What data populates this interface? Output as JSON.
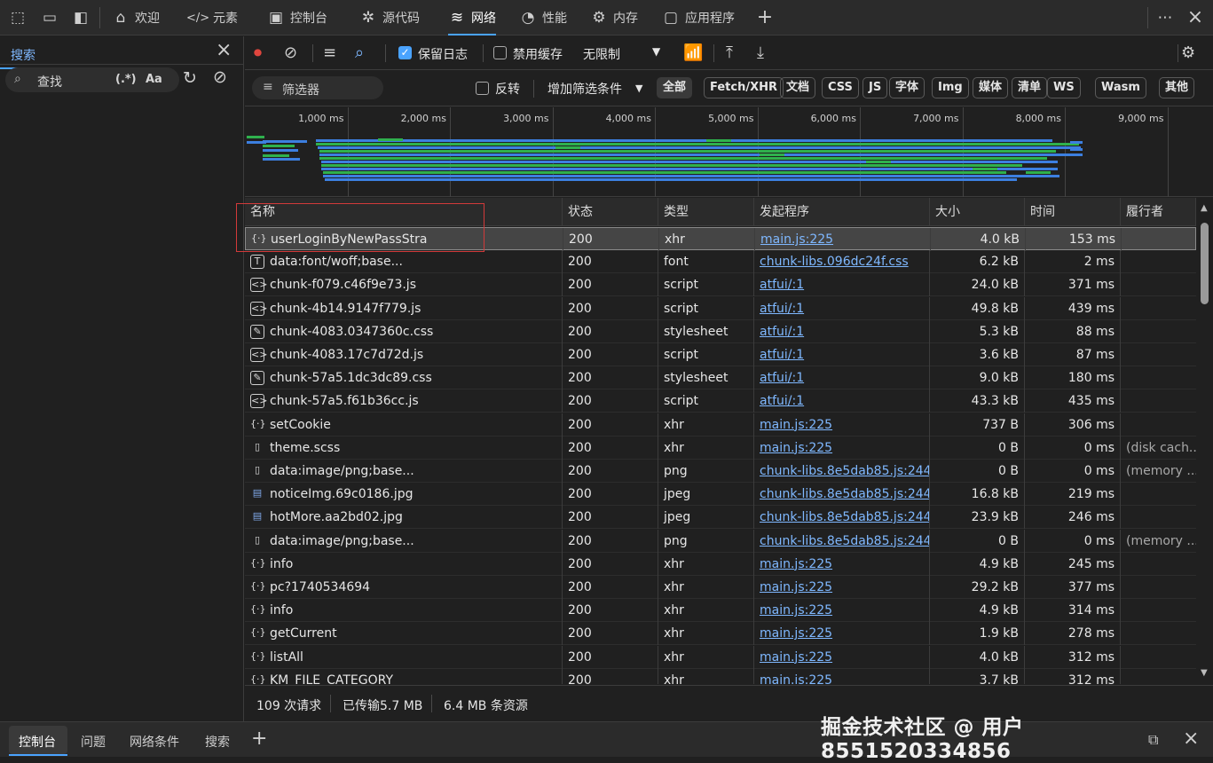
{
  "tabs": [
    {
      "label": "欢迎",
      "icon": "home-icon"
    },
    {
      "label": "元素",
      "icon": "code-icon"
    },
    {
      "label": "控制台",
      "icon": "console-icon"
    },
    {
      "label": "源代码",
      "icon": "bug-icon"
    },
    {
      "label": "网络",
      "icon": "wifi-icon",
      "active": true
    },
    {
      "label": "性能",
      "icon": "gauge-icon"
    },
    {
      "label": "内存",
      "icon": "chip-icon"
    },
    {
      "label": "应用程序",
      "icon": "window-icon"
    }
  ],
  "search_panel": {
    "title": "搜索",
    "placeholder": "查找",
    "regex_label": "(.*)",
    "case_label": "Aa"
  },
  "toolbar": {
    "preserve_log": "保留日志",
    "preserve_log_checked": true,
    "disable_cache": "禁用缓存",
    "disable_cache_checked": false,
    "throttling": "无限制"
  },
  "filter": {
    "placeholder": "筛选器",
    "invert": "反转",
    "more_filters": "增加筛选条件",
    "types": [
      "全部",
      "Fetch/XHR",
      "文档",
      "CSS",
      "JS",
      "字体",
      "Img",
      "媒体",
      "清单",
      "WS",
      "Wasm",
      "其他"
    ]
  },
  "timeline": {
    "ticks": [
      "1,000 ms",
      "2,000 ms",
      "3,000 ms",
      "4,000 ms",
      "5,000 ms",
      "6,000 ms",
      "7,000 ms",
      "8,000 ms",
      "9,000 ms"
    ]
  },
  "columns": [
    "名称",
    "状态",
    "类型",
    "发起程序",
    "大小",
    "时间",
    "履行者"
  ],
  "rows": [
    {
      "name": "userLoginByNewPassStra",
      "icon": "xhr-icon",
      "status": "200",
      "type": "xhr",
      "initiator": "main.js:225",
      "size": "4.0 kB",
      "time": "153 ms",
      "fulfilled": "",
      "selected": true
    },
    {
      "name": "data:font/woff;base...",
      "icon": "font-icon",
      "status": "200",
      "type": "font",
      "initiator": "chunk-libs.096dc24f.css",
      "size": "6.2 kB",
      "time": "2 ms",
      "fulfilled": ""
    },
    {
      "name": "chunk-f079.c46f9e73.js",
      "icon": "script-icon",
      "status": "200",
      "type": "script",
      "initiator": "atfui/:1",
      "size": "24.0 kB",
      "time": "371 ms",
      "fulfilled": ""
    },
    {
      "name": "chunk-4b14.9147f779.js",
      "icon": "script-icon",
      "status": "200",
      "type": "script",
      "initiator": "atfui/:1",
      "size": "49.8 kB",
      "time": "439 ms",
      "fulfilled": ""
    },
    {
      "name": "chunk-4083.0347360c.css",
      "icon": "stylesheet-icon",
      "status": "200",
      "type": "stylesheet",
      "initiator": "atfui/:1",
      "size": "5.3 kB",
      "time": "88 ms",
      "fulfilled": ""
    },
    {
      "name": "chunk-4083.17c7d72d.js",
      "icon": "script-icon",
      "status": "200",
      "type": "script",
      "initiator": "atfui/:1",
      "size": "3.6 kB",
      "time": "87 ms",
      "fulfilled": ""
    },
    {
      "name": "chunk-57a5.1dc3dc89.css",
      "icon": "stylesheet-icon",
      "status": "200",
      "type": "stylesheet",
      "initiator": "atfui/:1",
      "size": "9.0 kB",
      "time": "180 ms",
      "fulfilled": ""
    },
    {
      "name": "chunk-57a5.f61b36cc.js",
      "icon": "script-icon",
      "status": "200",
      "type": "script",
      "initiator": "atfui/:1",
      "size": "43.3 kB",
      "time": "435 ms",
      "fulfilled": ""
    },
    {
      "name": "setCookie",
      "icon": "xhr-icon",
      "status": "200",
      "type": "xhr",
      "initiator": "main.js:225",
      "size": "737 B",
      "time": "306 ms",
      "fulfilled": ""
    },
    {
      "name": "theme.scss",
      "icon": "document-icon",
      "status": "200",
      "type": "xhr",
      "initiator": "main.js:225",
      "size": "0 B",
      "time": "0 ms",
      "fulfilled": "(disk cach..."
    },
    {
      "name": "data:image/png;base...",
      "icon": "document-icon",
      "status": "200",
      "type": "png",
      "initiator": "chunk-libs.8e5dab85.js:244",
      "size": "0 B",
      "time": "0 ms",
      "fulfilled": "(memory ..."
    },
    {
      "name": "noticeImg.69c0186.jpg",
      "icon": "image-icon",
      "status": "200",
      "type": "jpeg",
      "initiator": "chunk-libs.8e5dab85.js:244",
      "size": "16.8 kB",
      "time": "219 ms",
      "fulfilled": ""
    },
    {
      "name": "hotMore.aa2bd02.jpg",
      "icon": "image-icon",
      "status": "200",
      "type": "jpeg",
      "initiator": "chunk-libs.8e5dab85.js:244",
      "size": "23.9 kB",
      "time": "246 ms",
      "fulfilled": ""
    },
    {
      "name": "data:image/png;base...",
      "icon": "document-icon",
      "status": "200",
      "type": "png",
      "initiator": "chunk-libs.8e5dab85.js:244",
      "size": "0 B",
      "time": "0 ms",
      "fulfilled": "(memory ..."
    },
    {
      "name": "info",
      "icon": "xhr-icon",
      "status": "200",
      "type": "xhr",
      "initiator": "main.js:225",
      "size": "4.9 kB",
      "time": "245 ms",
      "fulfilled": ""
    },
    {
      "name": "pc?1740534694",
      "icon": "xhr-icon",
      "status": "200",
      "type": "xhr",
      "initiator": "main.js:225",
      "size": "29.2 kB",
      "time": "377 ms",
      "fulfilled": ""
    },
    {
      "name": "info",
      "icon": "xhr-icon",
      "status": "200",
      "type": "xhr",
      "initiator": "main.js:225",
      "size": "4.9 kB",
      "time": "314 ms",
      "fulfilled": ""
    },
    {
      "name": "getCurrent",
      "icon": "xhr-icon",
      "status": "200",
      "type": "xhr",
      "initiator": "main.js:225",
      "size": "1.9 kB",
      "time": "278 ms",
      "fulfilled": ""
    },
    {
      "name": "listAll",
      "icon": "xhr-icon",
      "status": "200",
      "type": "xhr",
      "initiator": "main.js:225",
      "size": "4.0 kB",
      "time": "312 ms",
      "fulfilled": ""
    },
    {
      "name": "KM_FILE_CATEGORY",
      "icon": "xhr-icon",
      "status": "200",
      "type": "xhr",
      "initiator": "main.js:225",
      "size": "3.7 kB",
      "time": "312 ms",
      "fulfilled": ""
    }
  ],
  "status": {
    "requests": "109 次请求",
    "transferred": "已传输5.7 MB",
    "resources": "6.4 MB 条资源"
  },
  "drawer_tabs": [
    "控制台",
    "问题",
    "网络条件",
    "搜索"
  ],
  "watermark": "掘金技术社区 @ 用户8551520334856",
  "colors": {
    "accent": "#4aa3ff",
    "highlight": "#d23a3a",
    "green": "#2fb14d",
    "blue": "#3c7fe0"
  }
}
